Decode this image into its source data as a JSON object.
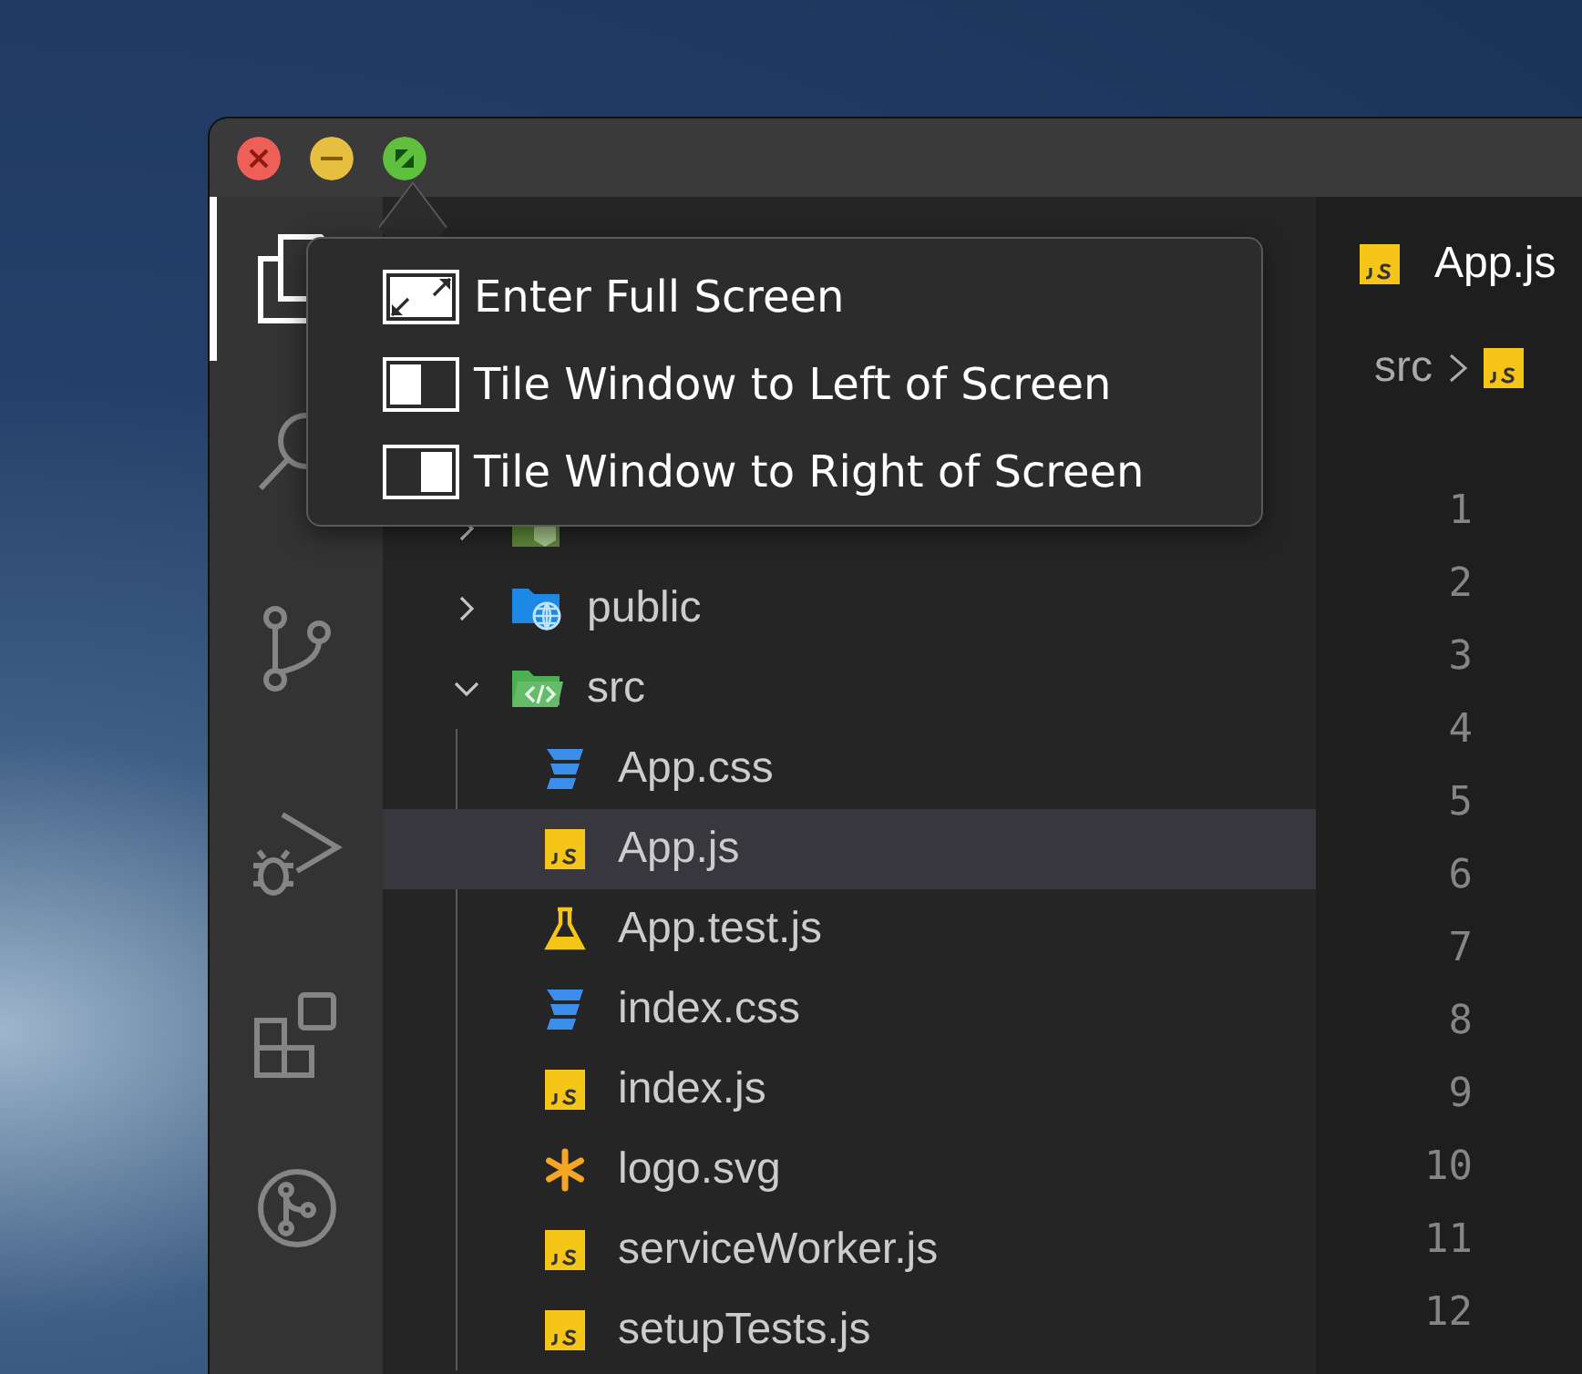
{
  "popup_menu": {
    "items": [
      {
        "label": "Enter Full Screen",
        "kind": "full"
      },
      {
        "label": "Tile Window to Left of Screen",
        "kind": "left"
      },
      {
        "label": "Tile Window to Right of Screen",
        "kind": "right"
      }
    ]
  },
  "activity_bar": {
    "items": [
      {
        "kind": "explorer",
        "selected": true
      },
      {
        "kind": "search",
        "selected": false
      },
      {
        "kind": "source-control",
        "selected": false
      },
      {
        "kind": "debug",
        "selected": false
      },
      {
        "kind": "extensions",
        "selected": false
      },
      {
        "kind": "git-graph",
        "selected": false
      }
    ]
  },
  "explorer": {
    "tree": [
      {
        "kind": "node-folder",
        "expanded": false,
        "selected": false
      },
      {
        "name": "public",
        "kind": "public-folder",
        "expanded": false,
        "selected": false
      },
      {
        "name": "src",
        "kind": "src-folder",
        "expanded": true,
        "selected": false,
        "children": [
          {
            "name": "App.css",
            "kind": "css",
            "selected": false
          },
          {
            "name": "App.js",
            "kind": "js",
            "selected": true
          },
          {
            "name": "App.test.js",
            "kind": "test",
            "selected": false
          },
          {
            "name": "index.css",
            "kind": "css",
            "selected": false
          },
          {
            "name": "index.js",
            "kind": "js",
            "selected": false
          },
          {
            "name": "logo.svg",
            "kind": "svg",
            "selected": false
          },
          {
            "name": "serviceWorker.js",
            "kind": "js",
            "selected": false
          },
          {
            "name": "setupTests.js",
            "kind": "js",
            "selected": false
          }
        ]
      }
    ]
  },
  "editor": {
    "tabs": [
      {
        "label": "App.js",
        "kind": "js",
        "selected": true
      }
    ],
    "breadcrumb": {
      "folder": "src"
    },
    "lines": [
      {
        "number": "1"
      },
      {
        "number": "2"
      },
      {
        "number": "3"
      },
      {
        "number": "4"
      },
      {
        "number": "5"
      },
      {
        "number": "6"
      },
      {
        "number": "7"
      },
      {
        "number": "8"
      },
      {
        "number": "9"
      },
      {
        "number": "10"
      },
      {
        "number": "11"
      },
      {
        "number": "12"
      }
    ]
  }
}
